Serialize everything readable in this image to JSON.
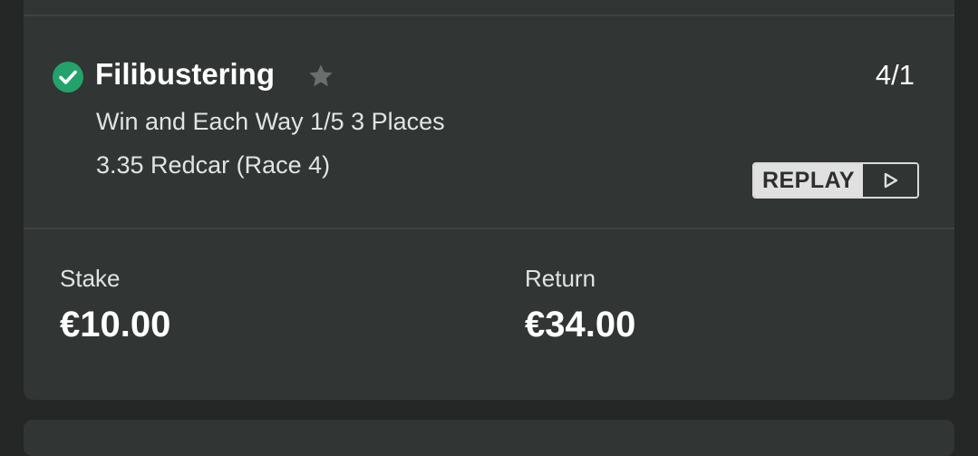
{
  "bet": {
    "status": "won",
    "status_icon": "check-circle-icon",
    "status_color": "#23a26b",
    "selection": "Filibustering",
    "favorite_icon": "star-icon",
    "odds": "4/1",
    "bet_type": "Win and Each Way 1/5 3 Places",
    "event": "3.35 Redcar (Race 4)",
    "replay_label": "REPLAY",
    "replay_icon": "play-icon"
  },
  "summary": {
    "stake_label": "Stake",
    "stake_value": "€10.00",
    "return_label": "Return",
    "return_value": "€34.00"
  },
  "colors": {
    "background": "#252726",
    "card": "#313533",
    "divider": "#3e4240",
    "text_primary": "#ffffff",
    "text_secondary": "#e2e4e3",
    "star": "#6b6e6c"
  }
}
